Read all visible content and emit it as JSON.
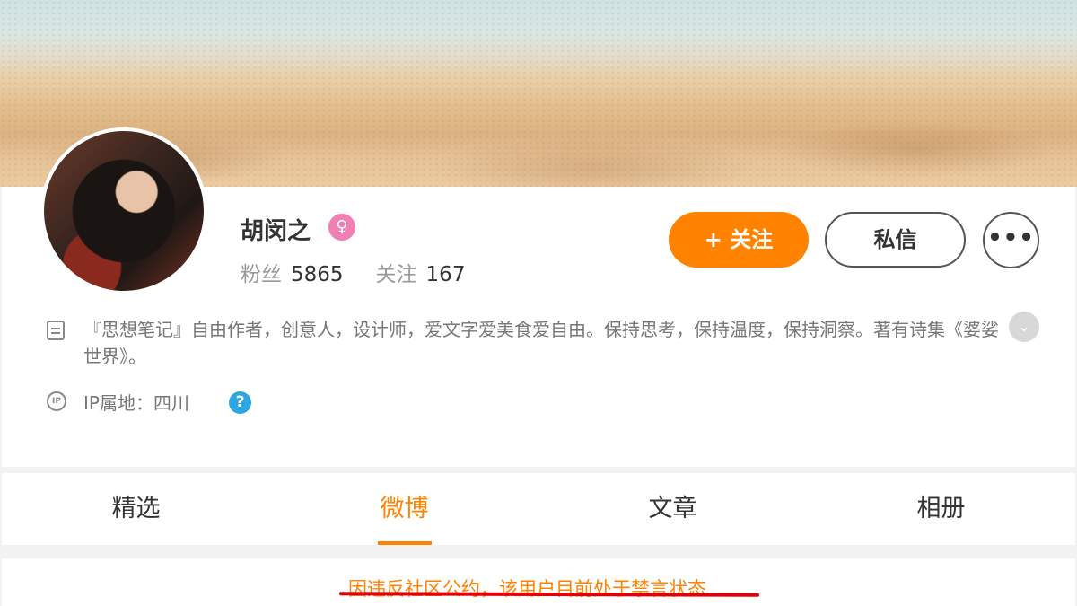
{
  "profile": {
    "name": "胡闵之",
    "gender_icon": "female-icon",
    "fans_label": "粉丝",
    "fans_count": "5865",
    "following_label": "关注",
    "following_count": "167",
    "bio": "『思想笔记』自由作者，创意人，设计师，爱文字爱美食爱自由。保持思考，保持温度，保持洞察。著有诗集《婆娑世界》。",
    "ip_location": "IP属地：四川"
  },
  "actions": {
    "follow_label": "+ 关注",
    "message_label": "私信",
    "more_label": "•••"
  },
  "icons": {
    "bio": "document-icon",
    "ip": "ip-icon",
    "help": "?",
    "expand": "⌄"
  },
  "tabs": [
    {
      "label": "精选"
    },
    {
      "label": "微博"
    },
    {
      "label": "文章"
    },
    {
      "label": "相册"
    }
  ],
  "active_tab": "微博",
  "notice": "因违反社区公约，该用户目前处于禁言状态",
  "colors": {
    "accent": "#ff8200",
    "female": "#f07fb3",
    "help": "#2ea7e0",
    "underline": "#e0000a"
  }
}
